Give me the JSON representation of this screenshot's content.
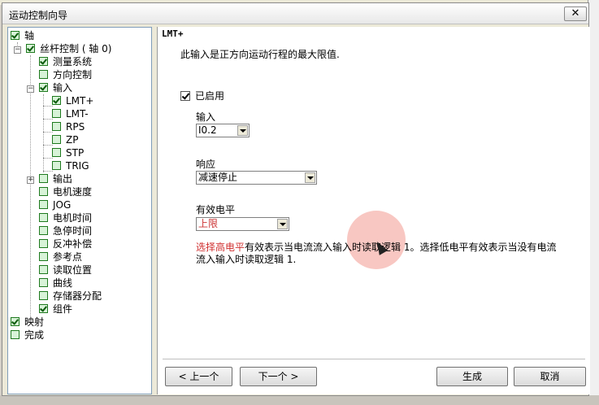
{
  "window": {
    "title": "运动控制向导",
    "close_icon": "close-icon"
  },
  "tree": {
    "axis": "轴",
    "screw": "丝杆控制 ( 轴 0)",
    "measure": "测量系统",
    "direction": "方向控制",
    "input": "输入",
    "lmt_plus": "LMT+",
    "lmt_minus": "LMT-",
    "rps": "RPS",
    "zp": "ZP",
    "stp": "STP",
    "trig": "TRIG",
    "output": "输出",
    "motor_speed": "电机速度",
    "jog": "JOG",
    "motor_time": "电机时间",
    "estop_time": "急停时间",
    "backlash": "反冲补偿",
    "ref_point": "参考点",
    "read_pos": "读取位置",
    "curve": "曲线",
    "mem_alloc": "存储器分配",
    "component": "组件",
    "mapping": "映射",
    "finish": "完成"
  },
  "page": {
    "title": "LMT+",
    "description": "此输入是正方向运动行程的最大限值.",
    "enabled_label": "已启用",
    "input_label": "输入",
    "input_value": "I0.2",
    "response_label": "响应",
    "response_value": "减速停止",
    "level_label": "有效电平",
    "level_value": "上限",
    "hint_part1": "选择高电平",
    "hint_part2": "有效表示当电流流入输入时读取逻辑 1。选择低电平有效表示当没有电流流入输入时读取逻辑 1."
  },
  "buttons": {
    "prev": "< 上一个",
    "next": "下一个 >",
    "finish": "生成",
    "cancel": "取消"
  },
  "colors": {
    "hint_highlight": "#d03030",
    "checkbox_green": "#1f7a1f"
  }
}
